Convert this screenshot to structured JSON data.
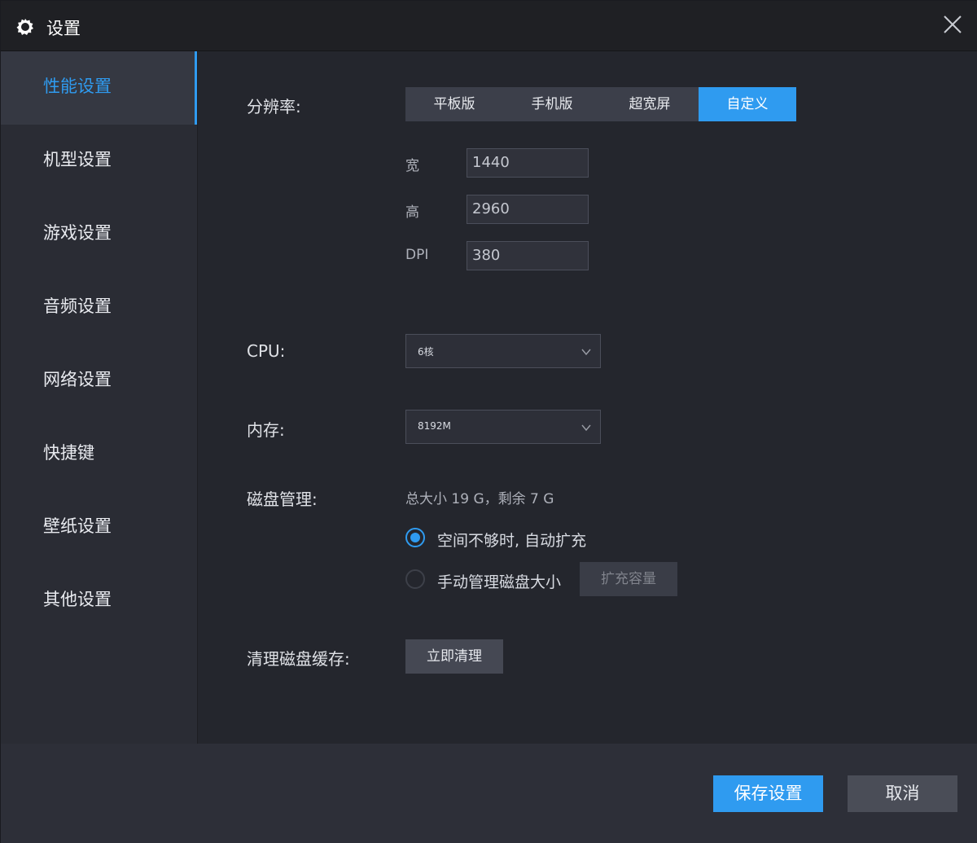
{
  "window": {
    "title": "设置"
  },
  "icons": {
    "app": "gear-icon",
    "close": "close-icon",
    "chevron": "chevron-down-icon"
  },
  "colors": {
    "accent": "#2f9bf0",
    "background": "#24262d",
    "sidebar": "#2a2c34"
  },
  "sidebar": {
    "items": [
      {
        "label": "性能设置",
        "active": true
      },
      {
        "label": "机型设置",
        "active": false
      },
      {
        "label": "游戏设置",
        "active": false
      },
      {
        "label": "音频设置",
        "active": false
      },
      {
        "label": "网络设置",
        "active": false
      },
      {
        "label": "快捷键",
        "active": false
      },
      {
        "label": "壁纸设置",
        "active": false
      },
      {
        "label": "其他设置",
        "active": false
      }
    ]
  },
  "resolution": {
    "label": "分辨率:",
    "options": [
      "平板版",
      "手机版",
      "超宽屏",
      "自定义"
    ],
    "selected": "自定义",
    "width_label": "宽",
    "width_value": "1440",
    "height_label": "高",
    "height_value": "2960",
    "dpi_label": "DPI",
    "dpi_value": "380"
  },
  "cpu": {
    "label": "CPU:",
    "value": "6核"
  },
  "memory": {
    "label": "内存:",
    "value": "8192M"
  },
  "disk": {
    "label": "磁盘管理:",
    "info": "总大小 19 G，剩余 7 G",
    "option_auto": "空间不够时, 自动扩充",
    "option_manual": "手动管理磁盘大小",
    "selected": "auto",
    "expand_button": "扩充容量"
  },
  "cache": {
    "label": "清理磁盘缓存:",
    "button": "立即清理"
  },
  "footer": {
    "save": "保存设置",
    "cancel": "取消"
  }
}
